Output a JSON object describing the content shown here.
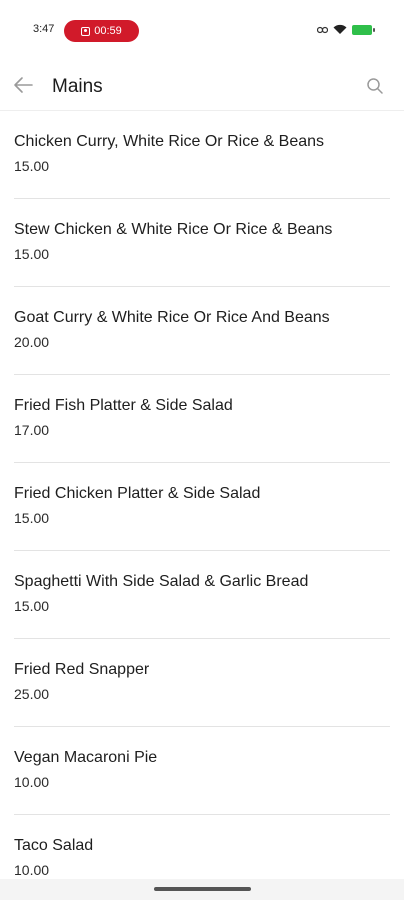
{
  "status_bar": {
    "time": "3:47",
    "recording_timer": "00:59",
    "icons": [
      "link-icon",
      "wifi-icon",
      "battery-icon"
    ]
  },
  "app_bar": {
    "title": "Mains",
    "back_icon": "arrow-left-icon",
    "search_icon": "search-icon"
  },
  "menu": {
    "items": [
      {
        "name": "Chicken Curry, White Rice Or Rice & Beans",
        "price": "15.00"
      },
      {
        "name": "Stew Chicken & White Rice Or Rice & Beans",
        "price": "15.00"
      },
      {
        "name": "Goat Curry & White Rice Or Rice And Beans",
        "price": "20.00"
      },
      {
        "name": "Fried Fish Platter & Side Salad",
        "price": "17.00"
      },
      {
        "name": "Fried Chicken Platter & Side Salad",
        "price": "15.00"
      },
      {
        "name": "Spaghetti With Side Salad & Garlic Bread",
        "price": "15.00"
      },
      {
        "name": "Fried Red Snapper",
        "price": "25.00"
      },
      {
        "name": "Vegan Macaroni Pie",
        "price": "10.00"
      },
      {
        "name": "Taco Salad",
        "price": "10.00"
      }
    ]
  },
  "colors": {
    "recording_pill": "#d11a2a",
    "battery": "#2fbf4a",
    "divider": "#e3e3e3"
  }
}
